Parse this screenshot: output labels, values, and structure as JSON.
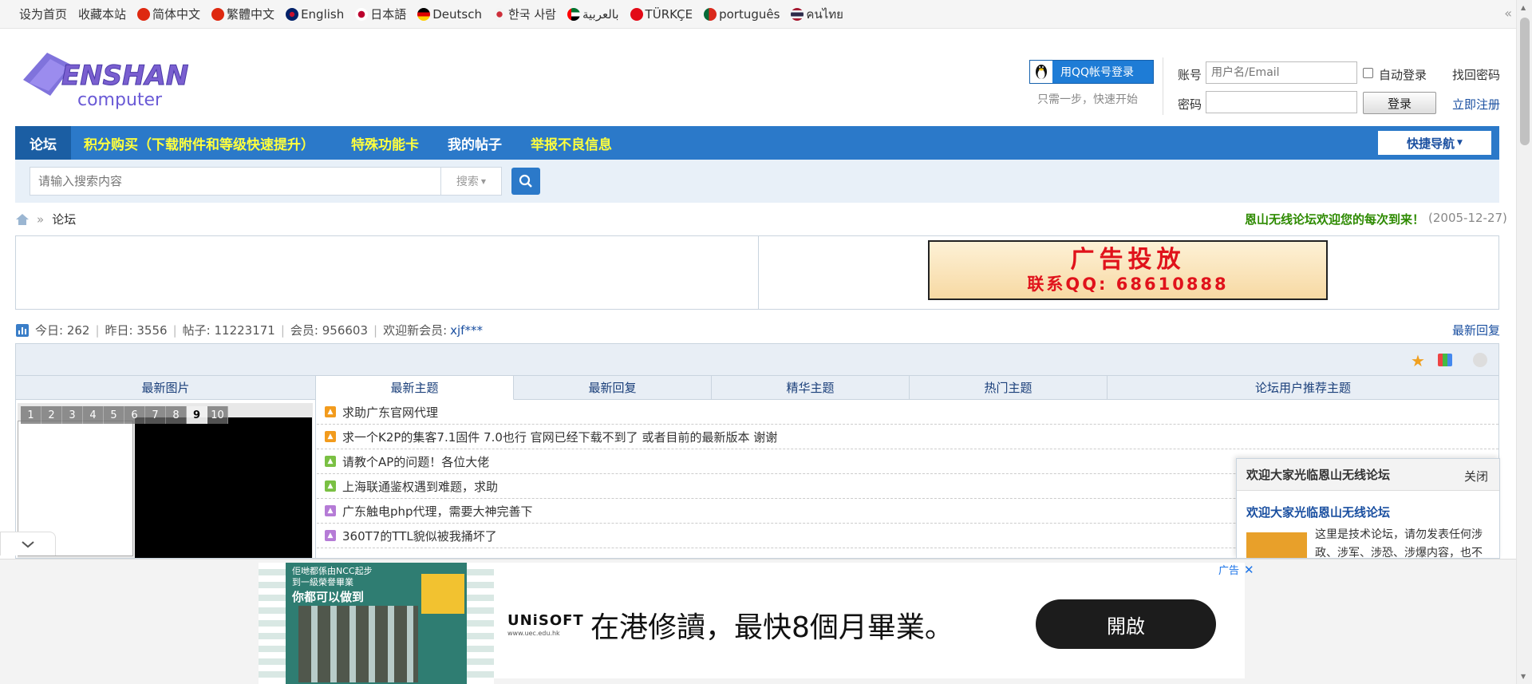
{
  "topbar": {
    "set_home": "设为首页",
    "bookmark": "收藏本站",
    "languages": [
      {
        "label": "简体中文",
        "flag_color": "#de2910"
      },
      {
        "label": "繁體中文",
        "flag_color": "#de2910"
      },
      {
        "label": "English",
        "flag_color": "#012169"
      },
      {
        "label": "日本語",
        "flag_color": "#bc002d"
      },
      {
        "label": "Deutsch",
        "flag_color": "#000000"
      },
      {
        "label": "한국 사람",
        "flag_color": "#cd2e3a"
      },
      {
        "label": "بالعربية",
        "flag_color": "#00732f"
      },
      {
        "label": "TÜRKÇE",
        "flag_color": "#e30a17"
      },
      {
        "label": "português",
        "flag_color": "#046a38"
      },
      {
        "label": "คนไทย",
        "flag_color": "#2d2a4a"
      }
    ],
    "collapse_icon": "double-chevron-left-icon"
  },
  "logo": {
    "word": "ENSHAN",
    "sub": "computer"
  },
  "login": {
    "qq_button": "用QQ帐号登录",
    "qq_hint": "只需一步，快速开始",
    "account_label": "账号",
    "account_placeholder": "用户名/Email",
    "auto_login": "自动登录",
    "forgot": "找回密码",
    "password_label": "密码",
    "login_button": "登录",
    "register": "立即注册"
  },
  "nav": {
    "items": [
      "论坛",
      "积分购买（下载附件和等级快速提升）",
      "特殊功能卡",
      "我的帖子",
      "举报不良信息"
    ],
    "quick_nav": "快捷导航"
  },
  "search": {
    "placeholder": "请输入搜索内容",
    "type": "搜索"
  },
  "breadcrumb": {
    "current": "论坛"
  },
  "welcome": {
    "text": "恩山无线论坛欢迎您的每次到来！",
    "date": "(2005-12-27)"
  },
  "ad_banner": {
    "title": "广告投放",
    "contact": "联系QQ: 68610888"
  },
  "stats": {
    "today_label": "今日:",
    "today": "262",
    "yesterday_label": "昨日:",
    "yesterday": "3556",
    "posts_label": "帖子:",
    "posts": "11223171",
    "members_label": "会员:",
    "members": "956603",
    "newmember_label": "欢迎新会员:",
    "newmember": "xjf***",
    "latest_reply": "最新回复"
  },
  "portal": {
    "tabs": [
      "最新图片",
      "最新主题",
      "最新回复",
      "精华主题",
      "热门主题",
      "论坛用户推荐主题"
    ],
    "pager": [
      "1",
      "2",
      "3",
      "4",
      "5",
      "6",
      "7",
      "8",
      "9",
      "10"
    ],
    "pager_active": "9",
    "topics": [
      {
        "title": "求助广东官网代理",
        "color": "#f29b1d"
      },
      {
        "title": "求一个K2P的集客7.1固件 7.0也行 官网已经下载不到了 或者目前的最新版本 谢谢",
        "color": "#f29b1d"
      },
      {
        "title": "请教个AP的问题！各位大佬",
        "color": "#7ac043"
      },
      {
        "title": "上海联通鉴权遇到难题，求助",
        "color": "#7ac043"
      },
      {
        "title": "广东触电php代理，需要大神完善下",
        "color": "#b57bd6"
      },
      {
        "title": "360T7的TTL貌似被我捅坏了",
        "color": "#b57bd6"
      }
    ]
  },
  "notice": {
    "header": "欢迎大家光临恩山无线论坛",
    "close": "关闭",
    "title": "欢迎大家光临恩山无线论坛",
    "text": "这里是技术论坛，请勿发表任何涉政、涉军、涉恐、涉爆内容，也不"
  },
  "bottom_ad": {
    "label": "广告",
    "brand": "UNiSOFT",
    "brand_sub": "www.uec.edu.hk",
    "poster_line1": "佢哋都係由NCC起步",
    "poster_line2": "到一級榮譽畢業",
    "poster_big": "你都可以做到",
    "headline": "在港修讀，最快8個月畢業。",
    "open_button": "開啟"
  }
}
